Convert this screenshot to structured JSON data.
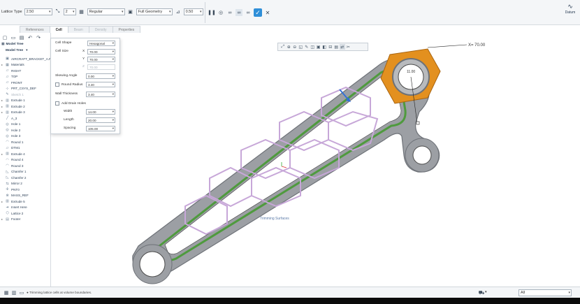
{
  "ribbon": {
    "lattice_type_label": "Lattice Type",
    "lattice_type_value": "2.50",
    "count_value": "2",
    "style_value": "Regular",
    "geometry_value": "Full Geometry",
    "thickness_value": "0.50",
    "datum_label": "Datum"
  },
  "tabs": [
    {
      "label": "References",
      "state": "normal"
    },
    {
      "label": "Cell",
      "state": "active"
    },
    {
      "label": "Beam",
      "state": "muted"
    },
    {
      "label": "Density",
      "state": "muted"
    },
    {
      "label": "Properties",
      "state": "normal"
    }
  ],
  "tree": {
    "header": "Model Tree",
    "items": [
      {
        "label": "AIRCRAFT_BRACKET_A.PRT",
        "icon": "part-icon",
        "expand": ""
      },
      {
        "label": "Materials",
        "icon": "materials-icon",
        "expand": "▸"
      },
      {
        "label": "RIGHT",
        "icon": "plane-icon",
        "expand": ""
      },
      {
        "label": "TOP",
        "icon": "plane-icon",
        "expand": ""
      },
      {
        "label": "FRONT",
        "icon": "plane-icon",
        "expand": ""
      },
      {
        "label": "PRT_CSYS_DEF",
        "icon": "csys-icon",
        "expand": ""
      },
      {
        "label": "Sketch 1",
        "icon": "sketch-icon",
        "expand": "",
        "muted": true
      },
      {
        "label": "Extrude 1",
        "icon": "extrude-icon",
        "expand": "▸"
      },
      {
        "label": "Extrude 2",
        "icon": "extrude-icon",
        "expand": "▸"
      },
      {
        "label": "Extrude 3",
        "icon": "extrude-icon",
        "expand": "▸"
      },
      {
        "label": "A_3",
        "icon": "axis-icon",
        "expand": ""
      },
      {
        "label": "Hole 1",
        "icon": "hole-icon",
        "expand": ""
      },
      {
        "label": "Hole 2",
        "icon": "hole-icon",
        "expand": ""
      },
      {
        "label": "Hole 3",
        "icon": "hole-icon",
        "expand": ""
      },
      {
        "label": "Round 1",
        "icon": "round-icon",
        "expand": ""
      },
      {
        "label": "DTM1",
        "icon": "plane-icon",
        "expand": ""
      },
      {
        "label": "Extrude 4",
        "icon": "extrude-icon",
        "expand": "▸"
      },
      {
        "label": "Round 4",
        "icon": "round-icon",
        "expand": ""
      },
      {
        "label": "Round 3",
        "icon": "round-icon",
        "expand": ""
      },
      {
        "label": "Chamfer 1",
        "icon": "chamfer-icon",
        "expand": ""
      },
      {
        "label": "Chamfer 2",
        "icon": "chamfer-icon",
        "expand": ""
      },
      {
        "label": "Mirror 2",
        "icon": "mirror-icon",
        "expand": ""
      },
      {
        "label": "PNT0",
        "icon": "point-icon",
        "expand": ""
      },
      {
        "label": "MASS_REF",
        "icon": "mass-icon",
        "expand": ""
      },
      {
        "label": "Extrude 5",
        "icon": "extrude-icon",
        "expand": "▸"
      },
      {
        "label": "Insert Here",
        "icon": "insert-arrow-icon",
        "expand": ""
      },
      {
        "label": "Lattice 2",
        "icon": "lattice-icon",
        "expand": ""
      },
      {
        "label": "Footer",
        "icon": "footer-icon",
        "expand": "▸"
      }
    ]
  },
  "cell_panel": {
    "cell_shape_label": "Cell Shape",
    "cell_shape_value": "Hexagonal",
    "cell_size_label": "Cell Size",
    "x_label": "X",
    "x_value": "70.00",
    "y_label": "Y",
    "y_value": "70.00",
    "z_label": "Z",
    "z_value": "70.00",
    "skewing_label": "Skewing Angle",
    "skewing_value": "0.00",
    "round_radius_label": "Round Radius",
    "round_radius_value": "3.40",
    "wall_thickness_label": "Wall Thickness",
    "wall_thickness_value": "3.40",
    "drain_holes_label": "Add Drain Holes",
    "width_label": "Width",
    "width_value": "14.00",
    "length_label": "Length",
    "length_value": "20.00",
    "spacing_label": "Spacing",
    "spacing_value": "105.00"
  },
  "viewport": {
    "dimension_x": "X= 70.00",
    "dimension_small": "11.00",
    "surface_label": "Trimming Surfaces"
  },
  "status": {
    "message": "● Trimming lattice cells at volume boundaries.",
    "filter_value": "All"
  },
  "colors": {
    "accent": "#2f8fd8",
    "lattice": "#c7a7d8",
    "hex_nut": "#e3901f",
    "bracket_outer": "#9c9fa4",
    "bracket_inner": "#4f9a3e"
  }
}
